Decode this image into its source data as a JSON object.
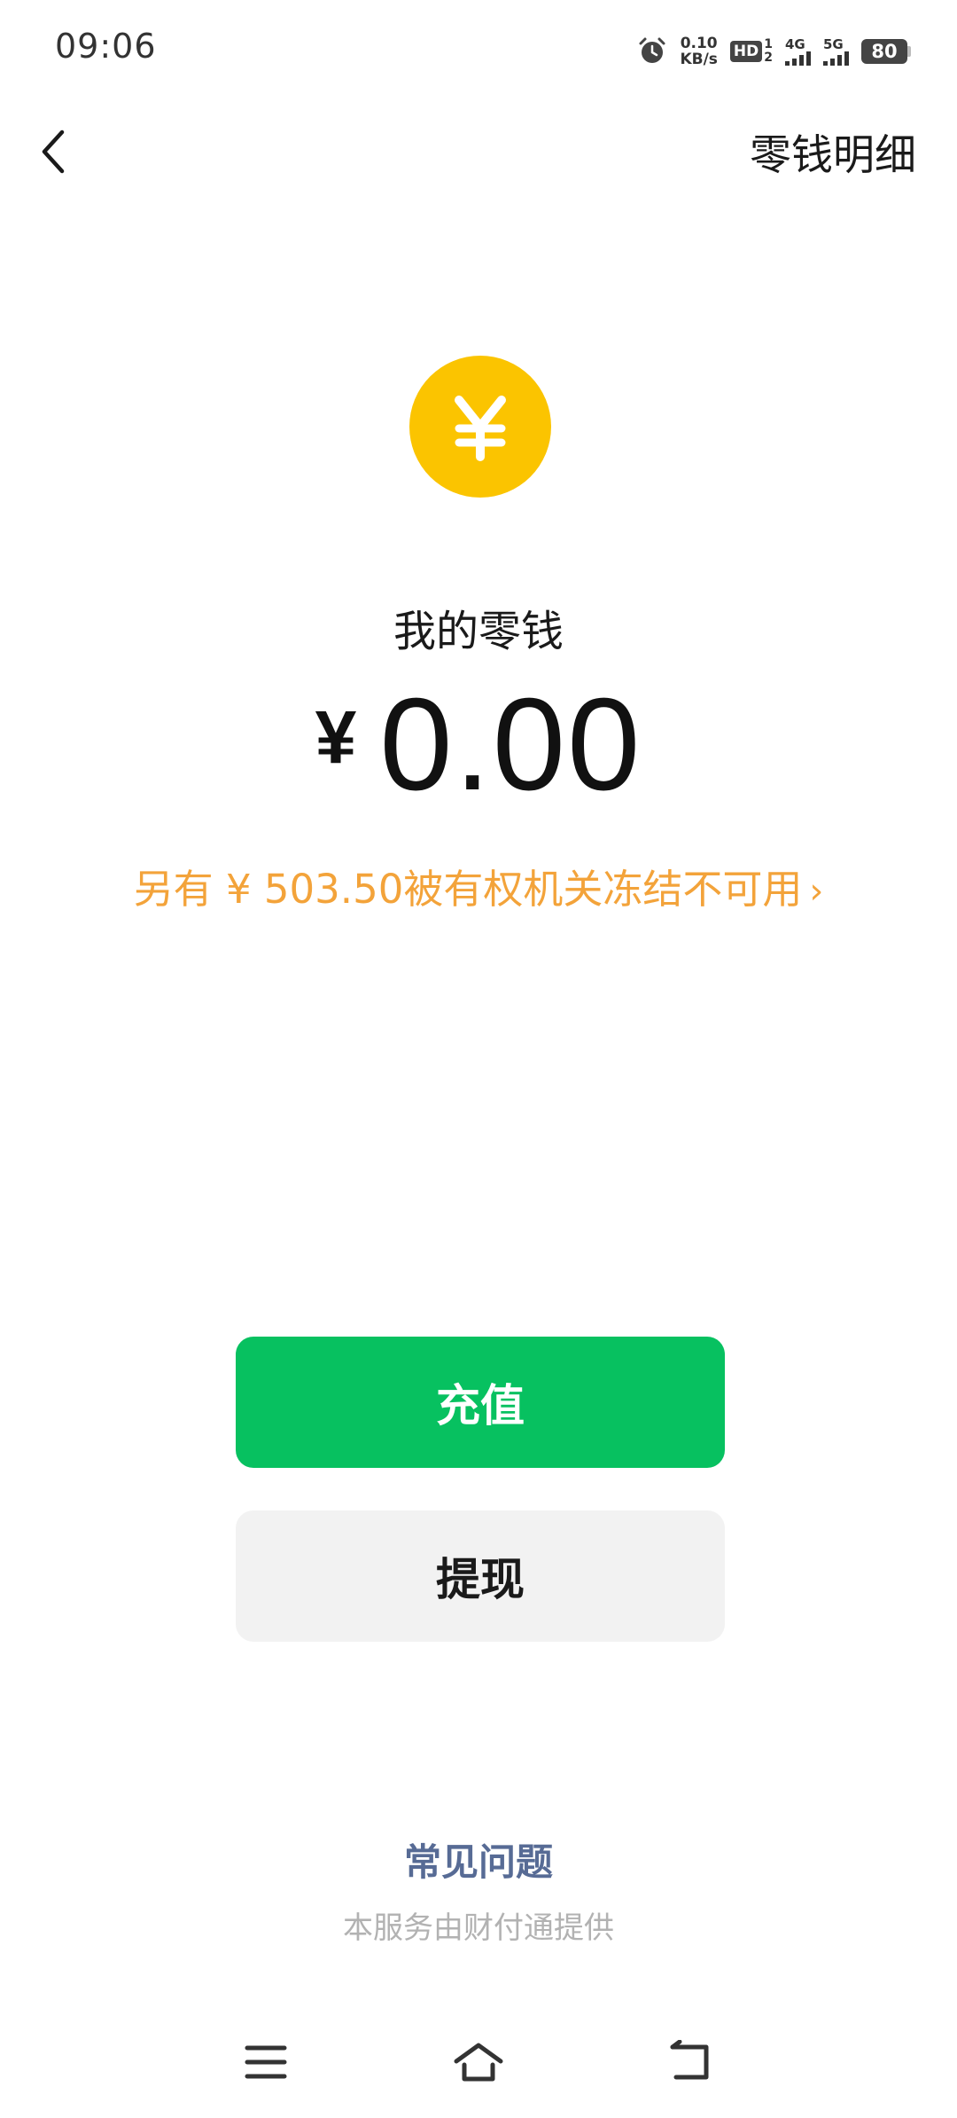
{
  "status_bar": {
    "time": "09:06",
    "net_speed_value": "0.10",
    "net_speed_unit": "KB/s",
    "hd_label": "HD",
    "hd_sim1": "1",
    "hd_sim2": "2",
    "signal1_label": "4G",
    "signal2_label": "5G",
    "battery": "80"
  },
  "header": {
    "detail_link": "零钱明细"
  },
  "balance": {
    "label": "我的零钱",
    "currency": "¥",
    "amount": "0.00",
    "frozen_notice": "另有 ¥ 503.50被有权机关冻结不可用",
    "frozen_chevron": "›"
  },
  "actions": {
    "recharge": "充值",
    "withdraw": "提现"
  },
  "footer": {
    "faq": "常见问题",
    "provider": "本服务由财付通提供"
  },
  "colors": {
    "coin": "#fbc400",
    "primary_green": "#07c160",
    "frozen_orange": "#f3a33a",
    "link_blue": "#576b95"
  }
}
